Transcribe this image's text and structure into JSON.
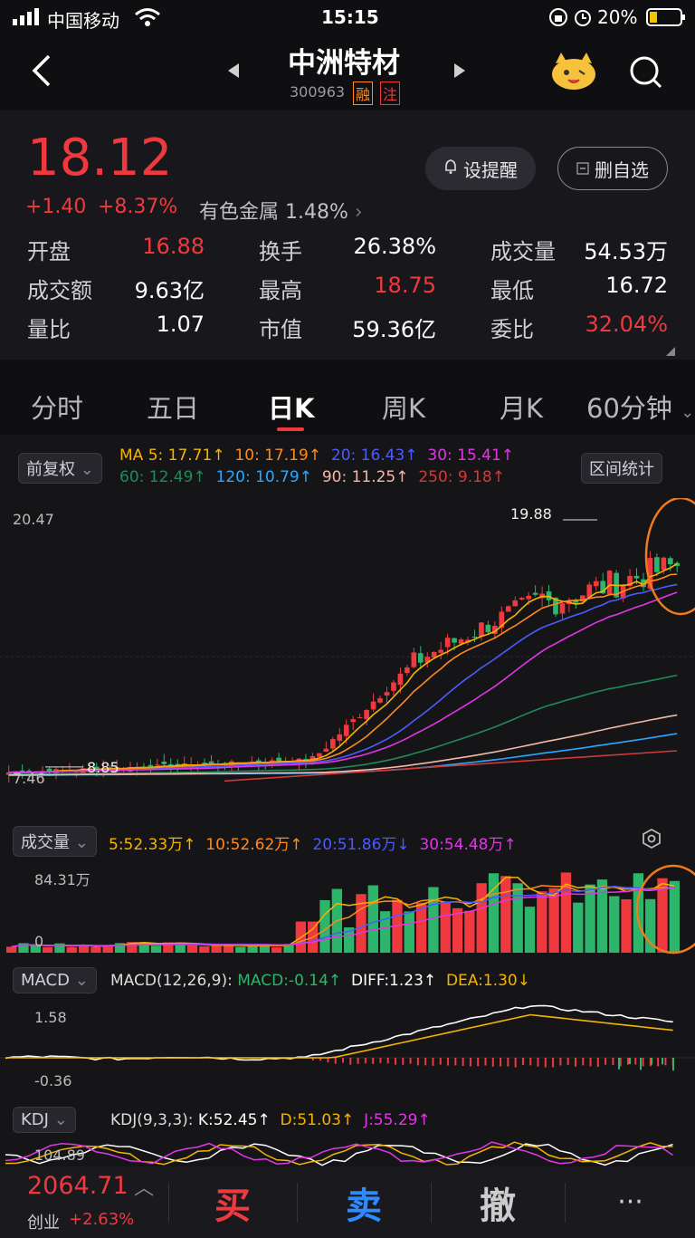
{
  "status": {
    "carrier": "中国移动",
    "time": "15:15",
    "battery": "20%"
  },
  "header": {
    "title": "中洲特材",
    "code": "300963",
    "tag1": "融",
    "tag2": "注"
  },
  "quote": {
    "price": "18.12",
    "change": "+1.40",
    "change_pct": "+8.37%",
    "sector": "有色金属",
    "sector_pct": "1.48%",
    "alert_btn": "设提醒",
    "remove_btn": "删自选",
    "stats": [
      [
        {
          "k": "开盘",
          "v": "16.88",
          "c": "red"
        },
        {
          "k": "换手",
          "v": "26.38%",
          "c": "white"
        },
        {
          "k": "成交量",
          "v": "54.53万",
          "c": "white"
        }
      ],
      [
        {
          "k": "成交额",
          "v": "9.63亿",
          "c": "white"
        },
        {
          "k": "最高",
          "v": "18.75",
          "c": "red"
        },
        {
          "k": "最低",
          "v": "16.72",
          "c": "white"
        }
      ],
      [
        {
          "k": "量比",
          "v": "1.07",
          "c": "white"
        },
        {
          "k": "市值",
          "v": "59.36亿",
          "c": "white"
        },
        {
          "k": "委比",
          "v": "32.04%",
          "c": "red"
        }
      ]
    ]
  },
  "tabs": [
    "分时",
    "五日",
    "日K",
    "周K",
    "月K",
    "60分钟"
  ],
  "kline": {
    "adjust": "前复权",
    "range_stats": "区间统计",
    "ma_row1": [
      {
        "t": "MA 5: 17.71↑",
        "c": "#f5b400"
      },
      {
        "t": "10: 17.19↑",
        "c": "#ff8a1e"
      },
      {
        "t": "20: 16.43↑",
        "c": "#4b5bff"
      },
      {
        "t": "30: 15.41↑",
        "c": "#e036e6"
      }
    ],
    "ma_row2": [
      {
        "t": "60: 12.49↑",
        "c": "#1f8a5a"
      },
      {
        "t": "120: 10.79↑",
        "c": "#2aa8ff"
      },
      {
        "t": "90: 11.25↑",
        "c": "#f2b8a8"
      },
      {
        "t": "250: 9.18↑",
        "c": "#d03a3a"
      }
    ],
    "max_label": "20.47",
    "min_label": "7.46",
    "high_mark": "19.88",
    "low_mark": "8.85"
  },
  "volume": {
    "title": "成交量",
    "top_label": "84.31万",
    "zero_label": "0",
    "ma": [
      {
        "t": "5:52.33万↑",
        "c": "#f5b400"
      },
      {
        "t": "10:52.62万↑",
        "c": "#ff8a1e"
      },
      {
        "t": "20:51.86万↓",
        "c": "#4b5bff"
      },
      {
        "t": "30:54.48万↑",
        "c": "#e036e6"
      }
    ]
  },
  "macd": {
    "title": "MACD",
    "params": "MACD(12,26,9):",
    "macd": "MACD:-0.14↑",
    "diff": "DIFF:1.23↑",
    "dea": "DEA:1.30↓",
    "top_label": "1.58",
    "bottom_label": "-0.36"
  },
  "kdj": {
    "title": "KDJ",
    "params": "KDJ(9,3,3):",
    "k": "K:52.45↑",
    "d": "D:51.03↑",
    "j": "J:55.29↑",
    "top_label": "104.89"
  },
  "bottom": {
    "index_value": "2064.71",
    "index_name": "创业",
    "index_pct": "+2.63%",
    "buy": "买",
    "sell": "卖",
    "cancel": "撤",
    "more": "···"
  }
}
